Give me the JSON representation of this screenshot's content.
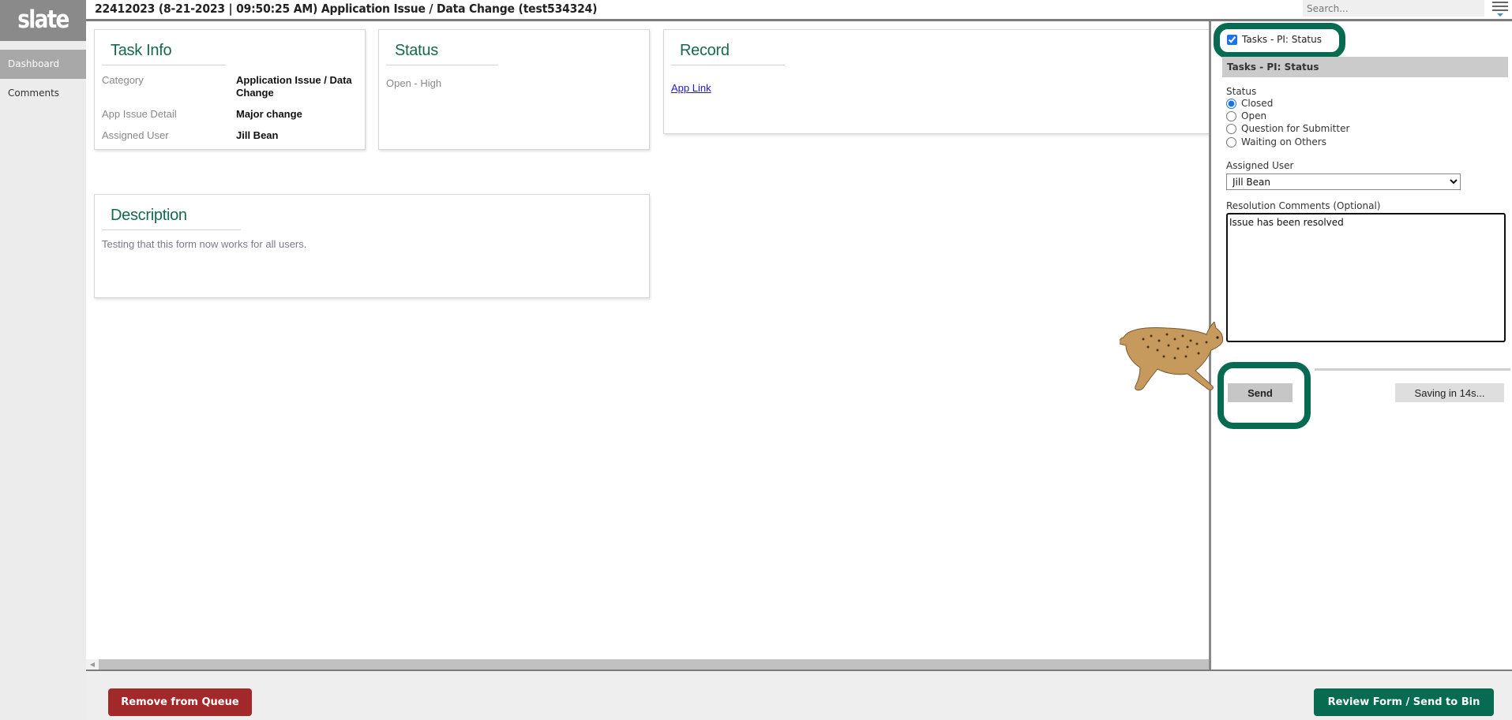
{
  "app": {
    "logo_text": "slate"
  },
  "sidebar": {
    "items": [
      {
        "label": "Dashboard",
        "active": true
      },
      {
        "label": "Comments",
        "active": false
      }
    ]
  },
  "header": {
    "title": "22412023 (8-21-2023 | 09:50:25 AM) Application Issue / Data Change (test534324)",
    "search_placeholder": "Search...",
    "menu_icon": "hamburger-menu-icon"
  },
  "cards": {
    "task_info": {
      "title": "Task Info",
      "fields": [
        {
          "label": "Category",
          "value": "Application Issue / Data Change"
        },
        {
          "label": "App Issue Detail",
          "value": "Major change"
        },
        {
          "label": "Assigned User",
          "value": "Jill Bean"
        }
      ]
    },
    "status": {
      "title": "Status",
      "value": "Open - High"
    },
    "record": {
      "title": "Record",
      "link_label": "App Link"
    },
    "description": {
      "title": "Description",
      "text": "Testing that this form now works for all users."
    }
  },
  "right_panel": {
    "checkbox_label": "Tasks - PI: Status",
    "checkbox_checked": true,
    "section_title": "Tasks - PI: Status",
    "status_label": "Status",
    "status_options": [
      {
        "label": "Closed",
        "checked": true
      },
      {
        "label": "Open",
        "checked": false
      },
      {
        "label": "Question for Submitter",
        "checked": false
      },
      {
        "label": "Waiting on Others",
        "checked": false
      }
    ],
    "assigned_user_label": "Assigned User",
    "assigned_user_value": "Jill Bean",
    "comments_label": "Resolution Comments (Optional)",
    "comments_value": "Issue has been resolved",
    "send_label": "Send",
    "saving_label": "Saving in 14s..."
  },
  "footer": {
    "remove_label": "Remove from Queue",
    "review_label": "Review Form / Send to Bin"
  },
  "colors": {
    "brand_green": "#066b50",
    "danger_red": "#a3282a",
    "heading_green": "#16694f",
    "link_blue": "#1a1aee"
  }
}
